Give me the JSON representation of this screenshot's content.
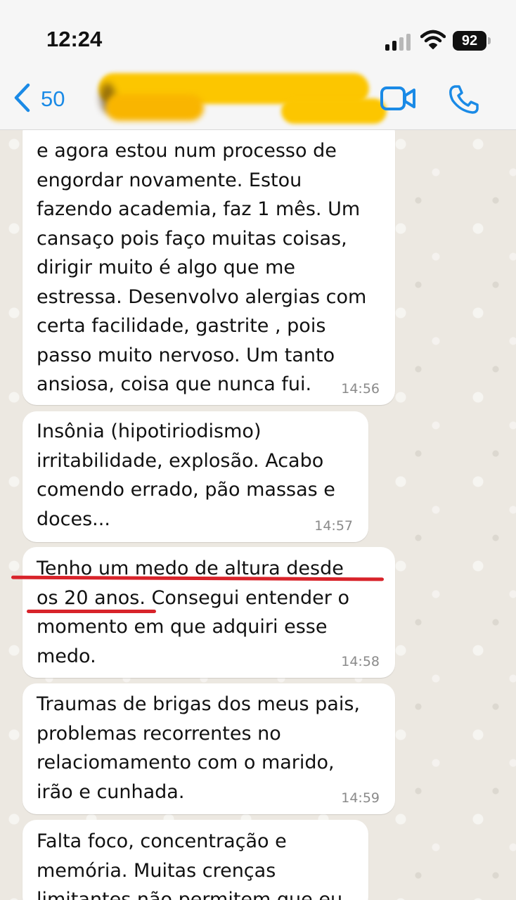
{
  "status_bar": {
    "time": "12:24",
    "battery": "92"
  },
  "header": {
    "back_count": "50",
    "icons": [
      "chevron-left-icon",
      "video-call-icon",
      "phone-call-icon"
    ]
  },
  "messages": [
    {
      "text": "e agora estou num processo de\nengordar novamente. Estou\nfazendo academia, faz 1 mês. Um\ncansaço pois faço muitas coisas,\ndirigir muito é algo que me\nestressa. Desenvolvo alergias com\ncerta facilidade, gastrite , pois\npasso muito nervoso. Um tanto\nansiosa, coisa que nunca fui.",
      "time": "14:56"
    },
    {
      "text": "Insônia (hipotiriodismo)\nirritabilidade, explosão. Acabo\ncomendo errado, pão massas e\ndoces...",
      "time": "14:57"
    },
    {
      "text": "Tenho um medo de altura desde\nos 20 anos. Consegui entender o\nmomento em que adquiri esse\nmedo.",
      "time": "14:58"
    },
    {
      "text": "Traumas de brigas dos meus pais,\nproblemas recorrentes no\nrelaciomamento com o marido,\nirão e cunhada.",
      "time": "14:59"
    },
    {
      "text": "Falta foco, concentração e\nmemória. Muitas crenças\nlimitantes não permitem que eu",
      "time": ""
    }
  ],
  "colors": {
    "accent": "#1a8ae6",
    "bubble": "#ffffff",
    "wallpaper": "#ece8e1",
    "highlight_mark": "#d8232a",
    "redaction": "#fcc600"
  }
}
